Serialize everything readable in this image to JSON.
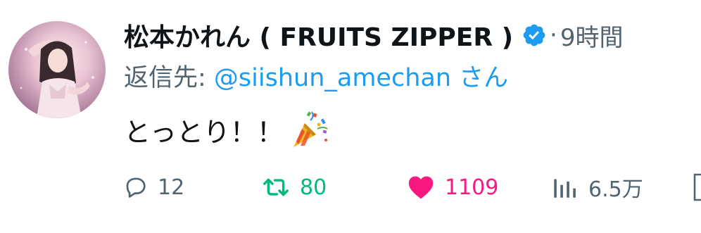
{
  "author": {
    "display_name": "松本かれん ( FRUITS ZIPPER )",
    "verified": true
  },
  "meta": {
    "separator": "·",
    "time": "9時間"
  },
  "reply": {
    "prefix": "返信先: ",
    "handle": "@siishun_amechan",
    "suffix": " さん"
  },
  "body": {
    "text": "とっとり！！",
    "emoji": "party-popper"
  },
  "actions": {
    "replies": "12",
    "retweets": "80",
    "likes": "1109",
    "views": "6.5万"
  },
  "colors": {
    "verified": "#1d9bf0",
    "handle": "#1d9bf0",
    "retweet": "#00ba7c",
    "like": "#f91880",
    "secondary": "#536471"
  }
}
